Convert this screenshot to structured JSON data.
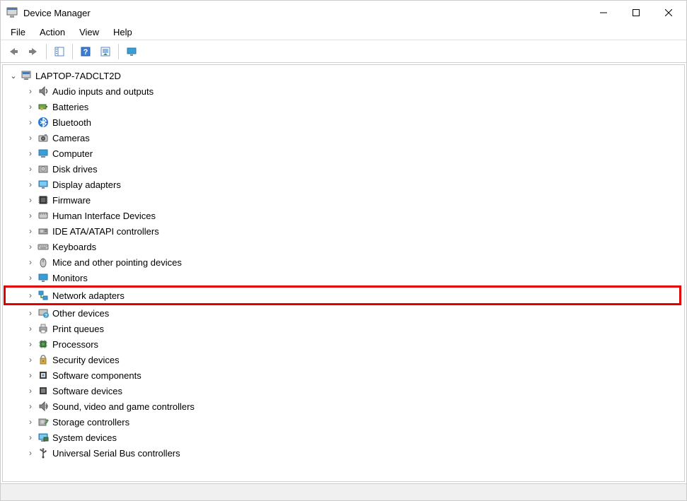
{
  "window": {
    "title": "Device Manager"
  },
  "menu": {
    "file": "File",
    "action": "Action",
    "view": "View",
    "help": "Help"
  },
  "tree": {
    "root": "LAPTOP-7ADCLT2D",
    "items": [
      {
        "label": "Audio inputs and outputs",
        "icon": "audio-icon"
      },
      {
        "label": "Batteries",
        "icon": "battery-icon"
      },
      {
        "label": "Bluetooth",
        "icon": "bluetooth-icon"
      },
      {
        "label": "Cameras",
        "icon": "camera-icon"
      },
      {
        "label": "Computer",
        "icon": "computer-icon"
      },
      {
        "label": "Disk drives",
        "icon": "disk-icon"
      },
      {
        "label": "Display adapters",
        "icon": "display-icon"
      },
      {
        "label": "Firmware",
        "icon": "firmware-icon"
      },
      {
        "label": "Human Interface Devices",
        "icon": "hid-icon"
      },
      {
        "label": "IDE ATA/ATAPI controllers",
        "icon": "ide-icon"
      },
      {
        "label": "Keyboards",
        "icon": "keyboard-icon"
      },
      {
        "label": "Mice and other pointing devices",
        "icon": "mouse-icon"
      },
      {
        "label": "Monitors",
        "icon": "monitor-icon"
      },
      {
        "label": "Network adapters",
        "icon": "network-icon",
        "highlighted": true
      },
      {
        "label": "Other devices",
        "icon": "other-icon"
      },
      {
        "label": "Print queues",
        "icon": "printer-icon"
      },
      {
        "label": "Processors",
        "icon": "cpu-icon"
      },
      {
        "label": "Security devices",
        "icon": "security-icon"
      },
      {
        "label": "Software components",
        "icon": "softcomp-icon"
      },
      {
        "label": "Software devices",
        "icon": "softdev-icon"
      },
      {
        "label": "Sound, video and game controllers",
        "icon": "sound-icon"
      },
      {
        "label": "Storage controllers",
        "icon": "storage-icon"
      },
      {
        "label": "System devices",
        "icon": "system-icon"
      },
      {
        "label": "Universal Serial Bus controllers",
        "icon": "usb-icon"
      }
    ]
  }
}
